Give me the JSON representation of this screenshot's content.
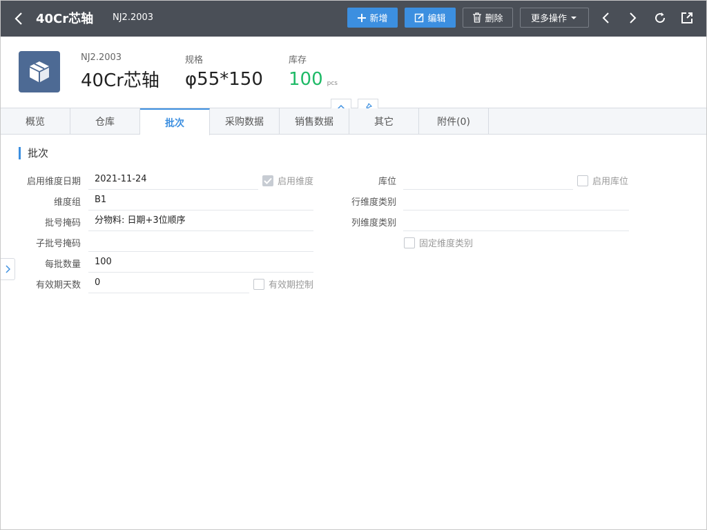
{
  "topbar": {
    "title": "40Cr芯轴",
    "code": "NJ2.2003",
    "buttons": {
      "new": "新增",
      "edit": "编辑",
      "delete": "删除",
      "more": "更多操作"
    }
  },
  "header": {
    "code_label": "NJ2.2003",
    "name": "40Cr芯轴",
    "spec_label": "规格",
    "spec_value": "φ55*150",
    "stock_label": "库存",
    "stock_value": "100",
    "stock_unit": "pcs"
  },
  "tabs": [
    "概览",
    "仓库",
    "批次",
    "采购数据",
    "销售数据",
    "其它",
    "附件(0)"
  ],
  "active_tab": "批次",
  "section": {
    "title": "批次"
  },
  "form": {
    "enable_date_label": "启用维度日期",
    "enable_date_value": "2021-11-24",
    "enable_dimension_label": "启用维度",
    "dimension_group_label": "维度组",
    "dimension_group_value": "B1",
    "batch_mask_label": "批号掩码",
    "batch_mask_value": "分物料: 日期+3位顺序",
    "sub_batch_mask_label": "子批号掩码",
    "sub_batch_mask_value": "",
    "per_batch_qty_label": "每批数量",
    "per_batch_qty_value": "100",
    "validity_days_label": "有效期天数",
    "validity_days_value": "0",
    "validity_control_label": "有效期控制",
    "location_label": "库位",
    "location_value": "",
    "enable_location_label": "启用库位",
    "row_dim_label": "行维度类别",
    "row_dim_value": "",
    "col_dim_label": "列维度类别",
    "col_dim_value": "",
    "fixed_dim_label": "固定维度类别"
  },
  "colors": {
    "topbar": "#4a4f57",
    "primary": "#3c8fe0",
    "stock": "#1fba67",
    "icon_bg": "#4d6a94"
  }
}
